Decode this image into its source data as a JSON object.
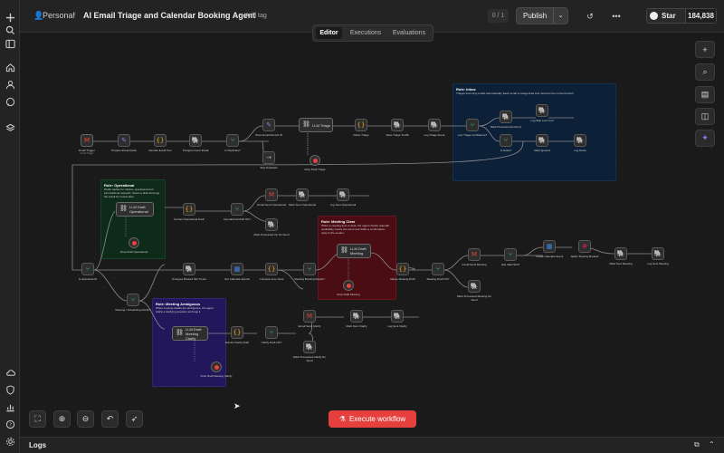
{
  "breadcrumb": {
    "project": "Personal",
    "workflow_title": "AI Email Triage and Calendar Booking Agent",
    "add_tag": "+ Add tag"
  },
  "header": {
    "version": "0 / 1",
    "publish": "Publish",
    "star_label": "Star",
    "star_count": "184,838"
  },
  "mode_tabs": [
    {
      "label": "Editor",
      "active": true
    },
    {
      "label": "Executions",
      "active": false
    },
    {
      "label": "Evaluations",
      "active": false
    }
  ],
  "notes": {
    "inbox": {
      "title": "Role: Inbox",
      "desc": "Triages incoming emails automatically. Each email is categorized and routed to the correct branch."
    },
    "operational": {
      "title": "Role: Operational",
      "desc": "Drafts replies for routine, operational and informational requests. Saves a draft and logs the result for review later."
    },
    "meeting_clear": {
      "title": "Role: Meeting Clear",
      "desc": "When a meeting time is clear, the agent checks calendar availability, books the event and drafts a confirmation reply to the sender."
    },
    "meeting_ambiguous": {
      "title": "Role: Meeting Ambiguous",
      "desc": "When meeting details are ambiguous, the agent drafts a clarifying question and logs it."
    }
  },
  "nodes": {
    "email_trigger": {
      "label": "Email Trigger",
      "sub": "Gmail Trigger"
    },
    "prepare_fields": {
      "label": "Prepare Email Fields",
      "sub": ""
    },
    "decode_body": {
      "label": "Decode Email Text",
      "sub": ""
    },
    "prepare_event": {
      "label": "Postgres Insert Email",
      "sub": "insert"
    },
    "is_duplicate": {
      "label": "Is Duplicate?",
      "sub": ""
    },
    "store_email": {
      "label": "Store Email Record ID",
      "sub": ""
    },
    "llm_triage": {
      "label": "LLM Triage",
      "sub": ""
    },
    "parse_triage": {
      "label": "Parse Triage",
      "sub": ""
    },
    "save_triage": {
      "label": "Save Triage To DB",
      "sub": ""
    },
    "log_triage": {
      "label": "Log Triage Event",
      "sub": ""
    },
    "low_conf": {
      "label": "Low Triage Confidence?",
      "sub": ""
    },
    "mark_low": {
      "label": "Mark Processed (Is Error)",
      "sub": ""
    },
    "log_low": {
      "label": "Log Skip Low Conf",
      "sub": ""
    },
    "is_noise": {
      "label": "Is Noise?",
      "sub": ""
    },
    "mark_ignored": {
      "label": "Mark Ignored",
      "sub": ""
    },
    "log_noise": {
      "label": "Log Noise",
      "sub": ""
    },
    "skip_dup": {
      "label": "Skip Duplicate",
      "sub": ""
    },
    "drop_triage": {
      "label": "Drop Draft Triage",
      "sub": ""
    },
    "llm_ops": {
      "label": "LLM Draft Operational",
      "sub": ""
    },
    "drop_ops": {
      "label": "Drop Draft Operational",
      "sub": ""
    },
    "extract_ops": {
      "label": "Extract Operational Draft",
      "sub": ""
    },
    "ops_draft_ok": {
      "label": "Operational Draft OK?",
      "sub": ""
    },
    "gmail_ops": {
      "label": "Gmail Send Operational",
      "sub": "draft: message"
    },
    "mark_sent_ops": {
      "label": "Mark Sent Operational",
      "sub": ""
    },
    "log_sent_ops": {
      "label": "Log Sent Operational",
      "sub": ""
    },
    "mark_proc_ops": {
      "label": "Mark Processed Op No Send",
      "sub": ""
    },
    "is_operational": {
      "label": "Is Operational?",
      "sub": ""
    },
    "meeting_sched": {
      "label": "Meeting / Scheduling Clarify?",
      "sub": ""
    },
    "postgres_meet": {
      "label": "Postgres Booked Slot Times",
      "sub": ""
    },
    "get_cal": {
      "label": "Get Calendar Events",
      "sub": "getAll: event"
    },
    "compute_slots": {
      "label": "Compute Free Slots",
      "sub": ""
    },
    "meeting_booking": {
      "label": "Meeting Booking Ready?",
      "sub": ""
    },
    "llm_meeting": {
      "label": "LLM Draft Meeting",
      "sub": ""
    },
    "drop_meeting": {
      "label": "Drop Draft Meeting",
      "sub": ""
    },
    "merge_meeting": {
      "label": "Merge Meeting Draft",
      "sub": ""
    },
    "meeting_ok": {
      "label": "Meeting Draft OK?",
      "sub": ""
    },
    "gmail_meeting": {
      "label": "Gmail Send Meeting",
      "sub": "draft: message"
    },
    "has_slots": {
      "label": "Has Valid Slot?",
      "sub": ""
    },
    "create_cal": {
      "label": "Create Calendar Event",
      "sub": "create: event"
    },
    "slack_book": {
      "label": "Slack: Meeting Booked",
      "sub": ""
    },
    "mark_meeting": {
      "label": "Mark Sent Meeting",
      "sub": ""
    },
    "log_meeting": {
      "label": "Log Sent Meeting",
      "sub": ""
    },
    "mark_proc_meet": {
      "label": "Mark Processed Meeting No Send",
      "sub": ""
    },
    "llm_clarify": {
      "label": "LLM Draft Meeting Clarify",
      "sub": ""
    },
    "drop_clarify": {
      "label": "Drop Draft Meeting Clarify",
      "sub": ""
    },
    "extract_clarify": {
      "label": "Extract Clarify Draft",
      "sub": ""
    },
    "clarify_ok": {
      "label": "Clarify Draft OK?",
      "sub": ""
    },
    "gmail_clarify": {
      "label": "Email Send Clarify",
      "sub": "draft: message"
    },
    "mark_clarify": {
      "label": "Mark Sent Clarify",
      "sub": ""
    },
    "log_clarify": {
      "label": "Log Sent Clarify",
      "sub": ""
    },
    "mark_proc_clar": {
      "label": "Mark Processed Clarify No Send",
      "sub": ""
    }
  },
  "bottom": {
    "execute": "Execute workflow",
    "logs": "Logs"
  },
  "colors": {
    "accent": "#e5403e",
    "note_blue": "#0c2038",
    "note_green": "#0e2a18",
    "note_red": "#4a0d14",
    "note_purple": "#22175a"
  }
}
